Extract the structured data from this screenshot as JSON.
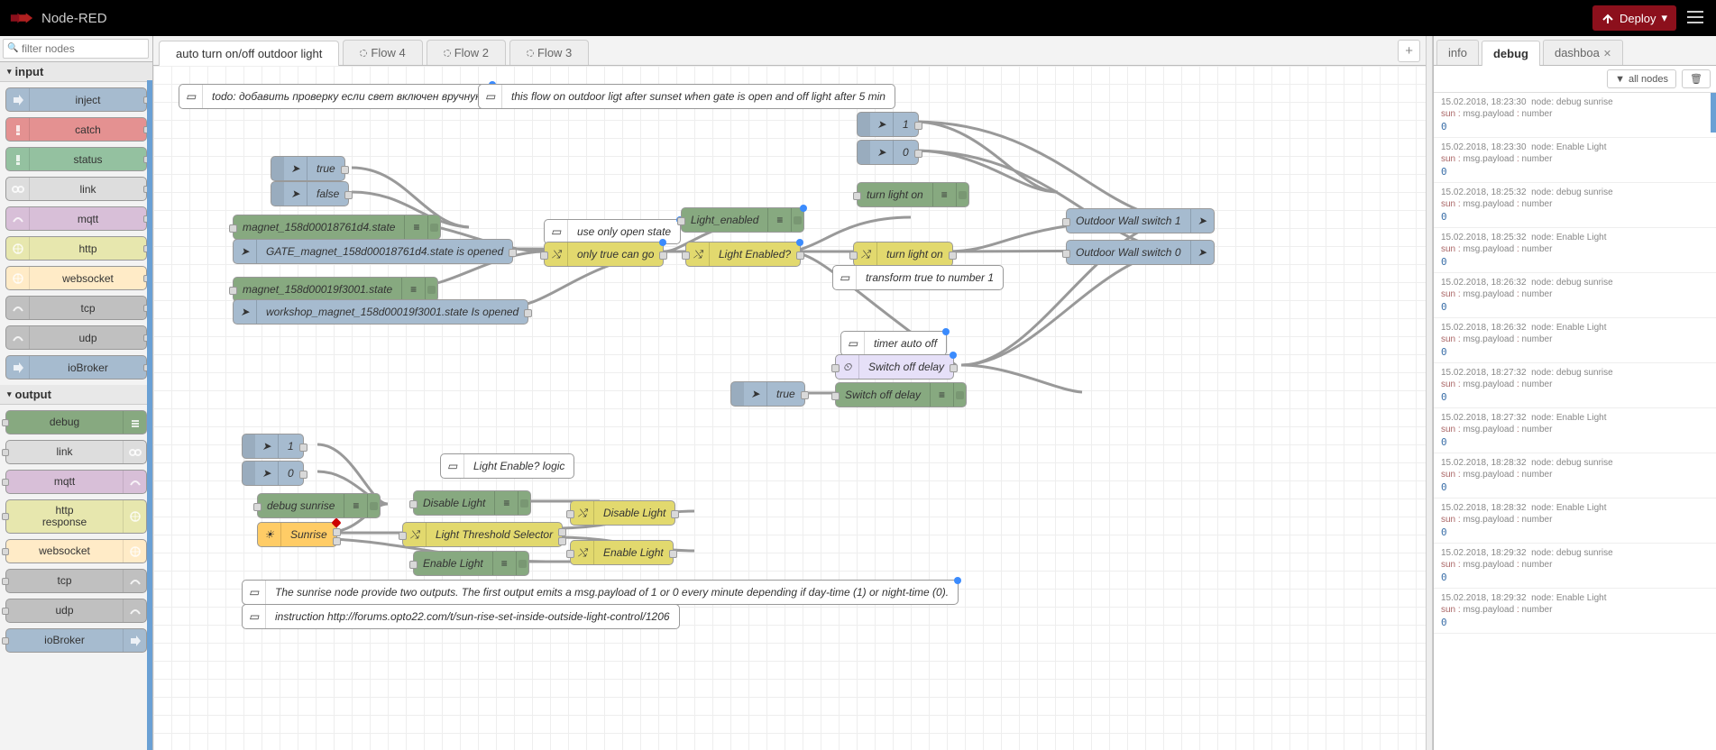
{
  "header": {
    "title": "Node-RED",
    "deploy": "Deploy"
  },
  "palette": {
    "filter_placeholder": "filter nodes",
    "cat_input": "input",
    "cat_output": "output",
    "inputs": [
      {
        "name": "inject",
        "color": "c-inject",
        "icon": "arrow"
      },
      {
        "name": "catch",
        "color": "c-catch",
        "icon": "excl"
      },
      {
        "name": "status",
        "color": "c-status",
        "icon": "excl"
      },
      {
        "name": "link",
        "color": "c-link",
        "icon": "link"
      },
      {
        "name": "mqtt",
        "color": "c-mqtt",
        "icon": "bridge"
      },
      {
        "name": "http",
        "color": "c-http",
        "icon": "globe"
      },
      {
        "name": "websocket",
        "color": "c-ws",
        "icon": "globe"
      },
      {
        "name": "tcp",
        "color": "c-tcp",
        "icon": "bridge"
      },
      {
        "name": "udp",
        "color": "c-udp",
        "icon": "bridge"
      },
      {
        "name": "ioBroker",
        "color": "c-iob",
        "icon": "arrow"
      }
    ],
    "outputs": [
      {
        "name": "debug",
        "color": "c-debug",
        "icon": "debug"
      },
      {
        "name": "link",
        "color": "c-link",
        "icon": "link"
      },
      {
        "name": "mqtt",
        "color": "c-mqtt",
        "icon": "bridge"
      },
      {
        "name": "http\nresponse",
        "color": "c-httpresp",
        "icon": "globe"
      },
      {
        "name": "websocket",
        "color": "c-ws",
        "icon": "globe"
      },
      {
        "name": "tcp",
        "color": "c-tcp",
        "icon": "bridge"
      },
      {
        "name": "udp",
        "color": "c-udp",
        "icon": "bridge"
      },
      {
        "name": "ioBroker",
        "color": "c-iob",
        "icon": "arrow"
      }
    ]
  },
  "tabs": {
    "t0": "auto turn on/off outdoor light",
    "t1": "Flow 4",
    "t2": "Flow 2",
    "t3": "Flow 3"
  },
  "nodes": {
    "comment1": "todo: добавить проверку если свет включен вручную",
    "comment2": "this flow on outdoor ligt after sunset when gate is open and off light after 5 min",
    "inj_true1": "true",
    "inj_false": "false",
    "inj_1a": "1",
    "inj_0a": "0",
    "inj_true2": "true",
    "inj_1b": "1",
    "inj_0b": "0",
    "magnet1": "magnet_158d00018761d4.state",
    "gate": "GATE_magnet_158d00018761d4.state is opened",
    "magnet2": "magnet_158d00019f3001.state",
    "workshop": "workshop_magnet_158d00019f3001.state Is opened",
    "comment_open": "use only open state",
    "only_true": "only true can go",
    "light_enabled_dbg": "Light_enabled",
    "light_enabled_sw": "Light Enabled?",
    "turn_on_dbg": "turn light on",
    "turn_on_ch": "turn light on",
    "comment_transform": "transform true to number 1",
    "comment_timer": "timer auto off",
    "switch_delay": "Switch off delay",
    "switch_delay_dbg": "Switch off delay",
    "wall1": "Outdoor Wall switch 1",
    "wall0": "Outdoor Wall switch 0",
    "debug_sunrise": "debug sunrise",
    "sunrise": "Sunrise",
    "comment_liglogic": "Light Enable? logic",
    "disable_dbg": "Disable Light",
    "enable_dbg": "Enable Light",
    "threshold": "Light Threshold Selector",
    "disable_ch": "Disable Light",
    "enable_ch": "Enable Light",
    "comment_sun1": "The sunrise node provide two outputs. The first output emits a msg.payload of 1 or 0 every minute depending if day-time (1) or night-time (0).",
    "comment_sun2": "instruction http://forums.opto22.com/t/sun-rise-set-inside-outside-light-control/1206"
  },
  "sidebar": {
    "tab_info": "info",
    "tab_debug": "debug",
    "tab_dash": "dashboa",
    "allnodes": "all nodes",
    "messages": [
      {
        "ts": "15.02.2018, 18:23:30",
        "node": "node: debug sunrise",
        "topic": "sun",
        "prop": "msg.payload",
        "type": "number",
        "val": "0"
      },
      {
        "ts": "15.02.2018, 18:23:30",
        "node": "node: Enable Light",
        "topic": "sun",
        "prop": "msg.payload",
        "type": "number",
        "val": "0"
      },
      {
        "ts": "15.02.2018, 18:25:32",
        "node": "node: debug sunrise",
        "topic": "sun",
        "prop": "msg.payload",
        "type": "number",
        "val": "0"
      },
      {
        "ts": "15.02.2018, 18:25:32",
        "node": "node: Enable Light",
        "topic": "sun",
        "prop": "msg.payload",
        "type": "number",
        "val": "0"
      },
      {
        "ts": "15.02.2018, 18:26:32",
        "node": "node: debug sunrise",
        "topic": "sun",
        "prop": "msg.payload",
        "type": "number",
        "val": "0"
      },
      {
        "ts": "15.02.2018, 18:26:32",
        "node": "node: Enable Light",
        "topic": "sun",
        "prop": "msg.payload",
        "type": "number",
        "val": "0"
      },
      {
        "ts": "15.02.2018, 18:27:32",
        "node": "node: debug sunrise",
        "topic": "sun",
        "prop": "msg.payload",
        "type": "number",
        "val": "0"
      },
      {
        "ts": "15.02.2018, 18:27:32",
        "node": "node: Enable Light",
        "topic": "sun",
        "prop": "msg.payload",
        "type": "number",
        "val": "0"
      },
      {
        "ts": "15.02.2018, 18:28:32",
        "node": "node: debug sunrise",
        "topic": "sun",
        "prop": "msg.payload",
        "type": "number",
        "val": "0"
      },
      {
        "ts": "15.02.2018, 18:28:32",
        "node": "node: Enable Light",
        "topic": "sun",
        "prop": "msg.payload",
        "type": "number",
        "val": "0"
      },
      {
        "ts": "15.02.2018, 18:29:32",
        "node": "node: debug sunrise",
        "topic": "sun",
        "prop": "msg.payload",
        "type": "number",
        "val": "0"
      },
      {
        "ts": "15.02.2018, 18:29:32",
        "node": "node: Enable Light",
        "topic": "sun",
        "prop": "msg.payload",
        "type": "number",
        "val": "0"
      }
    ]
  }
}
